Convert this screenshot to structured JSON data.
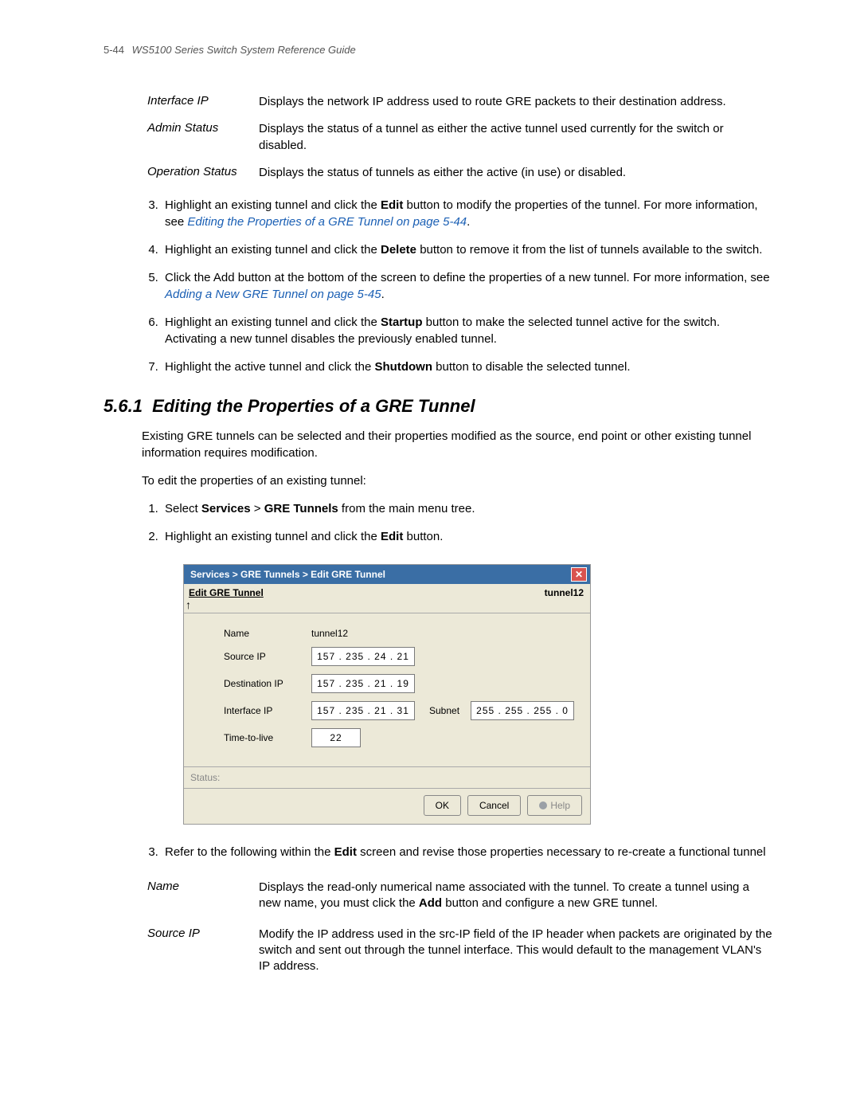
{
  "header": {
    "page_num": "5-44",
    "title": "WS5100 Series Switch System Reference Guide"
  },
  "top_defs": [
    {
      "term": "Interface IP",
      "desc_pre": "Displays",
      "desc_rest": " the network IP address used to route GRE packets to their destination address."
    },
    {
      "term": "Admin Status",
      "desc_pre": "",
      "desc_rest": "Displays the status of a tunnel as either the active tunnel used currently for the switch or disabled."
    },
    {
      "term": "Operation Status",
      "desc_pre": "",
      "desc_rest": "Displays the status of tunnels as either the active (in use) or disabled."
    }
  ],
  "steps_a": {
    "start": 3,
    "items": [
      {
        "pre": "Highlight an existing tunnel and click the ",
        "bold": "Edit",
        "post": " button to modify the properties of the tunnel. For more information, see ",
        "link": "Editing the Properties of a GRE Tunnel on page 5-44",
        "tail": "."
      },
      {
        "pre": "Highlight an existing tunnel and click the ",
        "bold": "Delete",
        "post": " button to remove it from the list of tunnels available to the switch.",
        "link": "",
        "tail": ""
      },
      {
        "pre": "Click the Add button at the bottom of the screen to define the properties of a new tunnel. For more information, see ",
        "bold": "",
        "post": "",
        "link": "Adding a New GRE Tunnel on page 5-45",
        "tail": "."
      },
      {
        "pre": "Highlight an existing tunnel and click the ",
        "bold": "Startup",
        "post": " button to make the selected tunnel active for the switch. Activating a new tunnel disables the previously enabled tunnel.",
        "link": "",
        "tail": ""
      },
      {
        "pre": "Highlight the active tunnel and click the ",
        "bold": "Shutdown",
        "post": " button to disable the selected tunnel.",
        "link": "",
        "tail": ""
      }
    ]
  },
  "section": {
    "number": "5.6.1",
    "title": "Editing the Properties of a GRE Tunnel",
    "para1": "Existing GRE tunnels can be selected and their properties modified as the source, end point or other existing tunnel information requires modification.",
    "para2": "To edit the properties of an existing tunnel:"
  },
  "steps_b": {
    "start": 1,
    "items": [
      {
        "pre": "Select ",
        "bold": "Services",
        "mid": " > ",
        "bold2": "GRE Tunnels",
        "post": " from the main menu tree."
      },
      {
        "pre": "Highlight an existing tunnel and click the ",
        "bold": "Edit",
        "mid": "",
        "bold2": "",
        "post": " button."
      }
    ]
  },
  "dialog": {
    "titlebar": "Services > GRE Tunnels > Edit GRE Tunnel",
    "close_glyph": "✕",
    "subtitle_left": "Edit GRE Tunnel",
    "subtitle_right": "tunnel12",
    "cursor": "↖",
    "fields": {
      "name_label": "Name",
      "name_value": "tunnel12",
      "source_label": "Source IP",
      "source_value": "157 . 235 .  24  .  21",
      "dest_label": "Destination IP",
      "dest_value": "157 . 235 .  21  .  19",
      "iface_label": "Interface IP",
      "iface_value": "157 . 235 .  21  .  31",
      "subnet_label": "Subnet",
      "subnet_value": "255 . 255 . 255 .   0",
      "ttl_label": "Time-to-live",
      "ttl_value": "22"
    },
    "status_label": "Status:",
    "buttons": {
      "ok": "OK",
      "cancel": "Cancel",
      "help": "Help"
    }
  },
  "steps_c": {
    "start": 3,
    "text_pre": "Refer to the following within the ",
    "text_bold": "Edit",
    "text_post": " screen and revise those properties necessary to re-create a functional tunnel"
  },
  "bottom_defs": [
    {
      "term": "Name",
      "desc_pre": "Displays the read-only numerical name associated with the tunnel. To create a tunnel using a new name, you must click the ",
      "bold": "Add",
      "desc_post": " button and configure a new GRE tunnel."
    },
    {
      "term": "Source IP",
      "desc_pre": "Modify the IP address used in the src-IP field of the IP header when packets are originated by the switch and sent out through the tunnel interface. This would default to the management VLAN's IP address.",
      "bold": "",
      "desc_post": ""
    }
  ]
}
